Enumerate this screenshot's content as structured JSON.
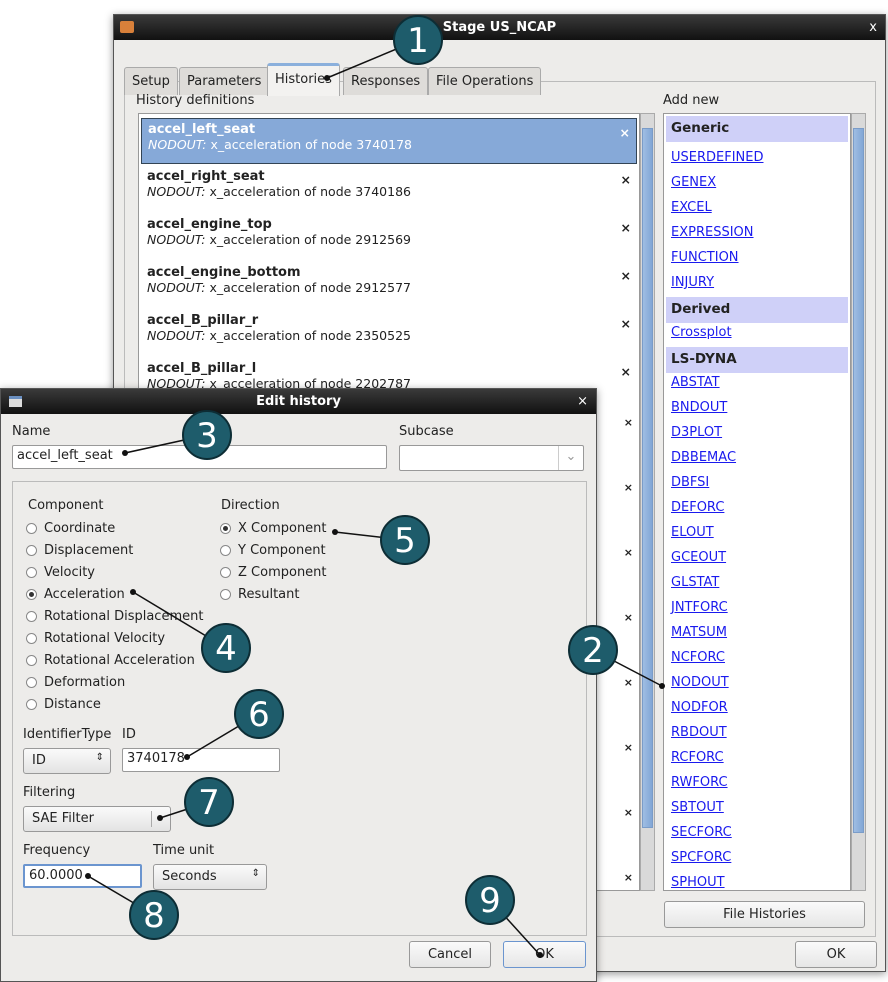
{
  "main_window": {
    "title": "Stage US_NCAP",
    "close": "x",
    "tabs": [
      {
        "label": "Setup"
      },
      {
        "label": "Parameters"
      },
      {
        "label": "Histories"
      },
      {
        "label": "Responses"
      },
      {
        "label": "File Operations"
      }
    ],
    "history_label": "History definitions",
    "histories": [
      {
        "name": "accel_left_seat",
        "source": "NODOUT:",
        "desc": " x_acceleration of node 3740178"
      },
      {
        "name": "accel_right_seat",
        "source": "NODOUT:",
        "desc": " x_acceleration of node 3740186"
      },
      {
        "name": "accel_engine_top",
        "source": "NODOUT:",
        "desc": " x_acceleration of node 2912569"
      },
      {
        "name": "accel_engine_bottom",
        "source": "NODOUT:",
        "desc": " x_acceleration of node 2912577"
      },
      {
        "name": "accel_B_pillar_r",
        "source": "NODOUT:",
        "desc": " x_acceleration of node 2350525"
      },
      {
        "name": "accel_B_pillar_l",
        "source": "NODOUT:",
        "desc": " x_acceleration of node 2202787"
      }
    ],
    "delete_glyph": "×",
    "add_new_label": "Add new",
    "add_new": {
      "generic_header": "Generic",
      "generic": [
        "USERDEFINED",
        "GENEX",
        "EXCEL",
        "EXPRESSION",
        "FUNCTION",
        "INJURY"
      ],
      "derived_header": "Derived",
      "derived": [
        "Crossplot"
      ],
      "lsdyna_header": "LS-DYNA",
      "lsdyna": [
        "ABSTAT",
        "BNDOUT",
        "D3PLOT",
        "DBBEMAC",
        "DBFSI",
        "DEFORC",
        "ELOUT",
        "GCEOUT",
        "GLSTAT",
        "JNTFORC",
        "MATSUM",
        "NCFORC",
        "NODOUT",
        "NODFOR",
        "RBDOUT",
        "RCFORC",
        "RWFORC",
        "SBTOUT",
        "SECFORC",
        "SPCFORC",
        "SPHOUT"
      ]
    },
    "file_histories": "File Histories",
    "ok": "OK"
  },
  "edit_dialog": {
    "title": "Edit history",
    "close": "×",
    "name_label": "Name",
    "name_value": "accel_left_seat",
    "subcase_label": "Subcase",
    "subcase_value": "",
    "component_label": "Component",
    "components": [
      "Coordinate",
      "Displacement",
      "Velocity",
      "Acceleration",
      "Rotational Displacement",
      "Rotational Velocity",
      "Rotational Acceleration",
      "Deformation",
      "Distance"
    ],
    "component_selected": "Acceleration",
    "direction_label": "Direction",
    "directions": [
      "X Component",
      "Y Component",
      "Z Component",
      "Resultant"
    ],
    "direction_selected": "X Component",
    "identifier_type_label": "IdentifierType",
    "identifier_type": "ID",
    "id_label": "ID",
    "id_value": "3740178",
    "filtering_label": "Filtering",
    "filtering": "SAE Filter",
    "frequency_label": "Frequency",
    "frequency": "60.0000",
    "time_unit_label": "Time unit",
    "time_unit": "Seconds",
    "cancel": "Cancel",
    "ok": "OK"
  },
  "callouts": [
    "1",
    "2",
    "3",
    "4",
    "5",
    "6",
    "7",
    "8",
    "9"
  ],
  "colors": {
    "callout": "#1e5c6b",
    "selection": "#86a9d8",
    "link": "#1a1aee",
    "header": "#cfd0f8"
  }
}
